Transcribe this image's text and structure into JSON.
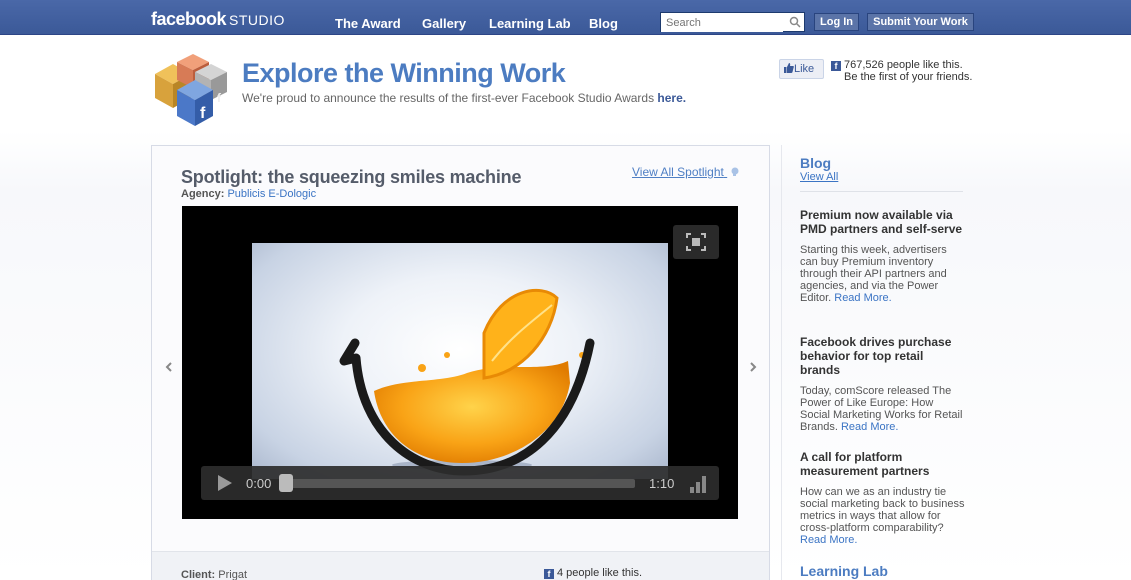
{
  "topbar": {
    "logo": "facebook",
    "logo_sub": "STUDIO",
    "nav": [
      "The Award",
      "Gallery",
      "Learning Lab",
      "Blog"
    ],
    "search_placeholder": "Search",
    "login_label": "Log In",
    "submit_label": "Submit Your Work"
  },
  "header": {
    "title": "Explore the Winning Work",
    "subtitle": "We're proud to announce the results of the first-ever Facebook Studio Awards",
    "subtitle_link": "here.",
    "like_label": "Like",
    "like_count_text": "767,526 people like this.",
    "like_friends_text": "Be the first of your friends."
  },
  "spotlight": {
    "title": "Spotlight: the squeezing smiles machine",
    "view_all": "View All Spotlight",
    "agency_label": "Agency:",
    "agency_name": "Publicis E-Dologic",
    "client_label": "Client:",
    "client_name": "Prigat",
    "people_like": "4 people like this."
  },
  "video": {
    "current_time": "0:00",
    "duration": "1:10",
    "progress": 0
  },
  "sidebar": {
    "heading": "Blog",
    "view_all": "View All",
    "posts": [
      {
        "title": "Premium now available via PMD partners and self-serve",
        "body": "Starting this week, advertisers can buy Premium inventory through their API partners and agencies, and via the Power Editor.",
        "more": "Read More."
      },
      {
        "title": "Facebook drives purchase behavior for top retail brands",
        "body": "Today, comScore released The Power of Like Europe: How Social Marketing Works for Retail Brands.",
        "more": "Read More."
      },
      {
        "title": "A call for platform measurement partners",
        "body": "How can we as an industry tie social marketing back to business metrics in ways that allow for cross-platform comparability?",
        "more": "Read More."
      }
    ],
    "next_heading": "Learning Lab"
  },
  "colors": {
    "brand_blue": "#3b5998",
    "title_blue": "#4c7cc1",
    "link_blue": "#3b74c4"
  }
}
